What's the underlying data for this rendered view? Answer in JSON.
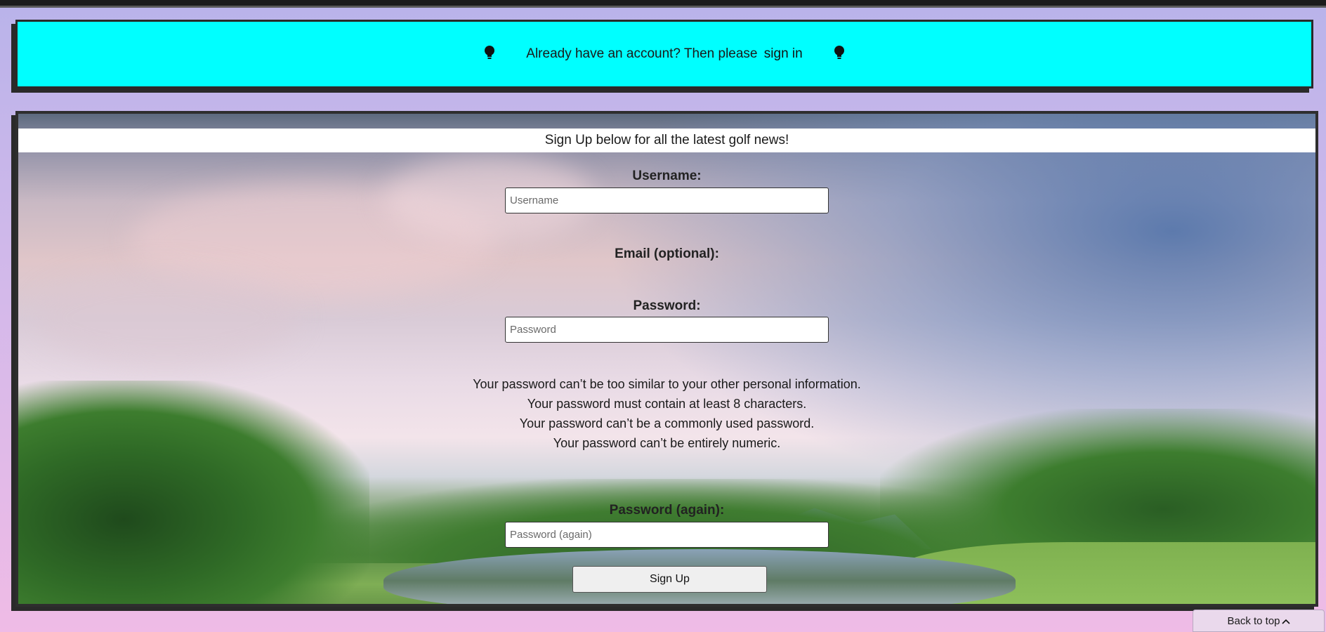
{
  "banner": {
    "icon_left": "lightbulb-icon",
    "icon_right": "lightbulb-icon",
    "text": "Already have an account? Then please",
    "link": "sign in",
    "background": "#00ffff"
  },
  "form": {
    "notice": "Sign Up below for all the latest golf news!",
    "username": {
      "label": "Username:",
      "placeholder": "Username",
      "value": ""
    },
    "email": {
      "label": "Email (optional):"
    },
    "password": {
      "label": "Password:",
      "placeholder": "Password",
      "value": ""
    },
    "password_help": [
      "Your password can’t be too similar to your other personal information.",
      "Your password must contain at least 8 characters.",
      "Your password can’t be a commonly used password.",
      "Your password can’t be entirely numeric."
    ],
    "password_again": {
      "label": "Password (again):",
      "placeholder": "Password (again)",
      "value": ""
    },
    "submit_label": "Sign Up"
  },
  "footer": {
    "back_to_top": "Back to top",
    "back_to_top_icon": "chevron-up-icon"
  }
}
